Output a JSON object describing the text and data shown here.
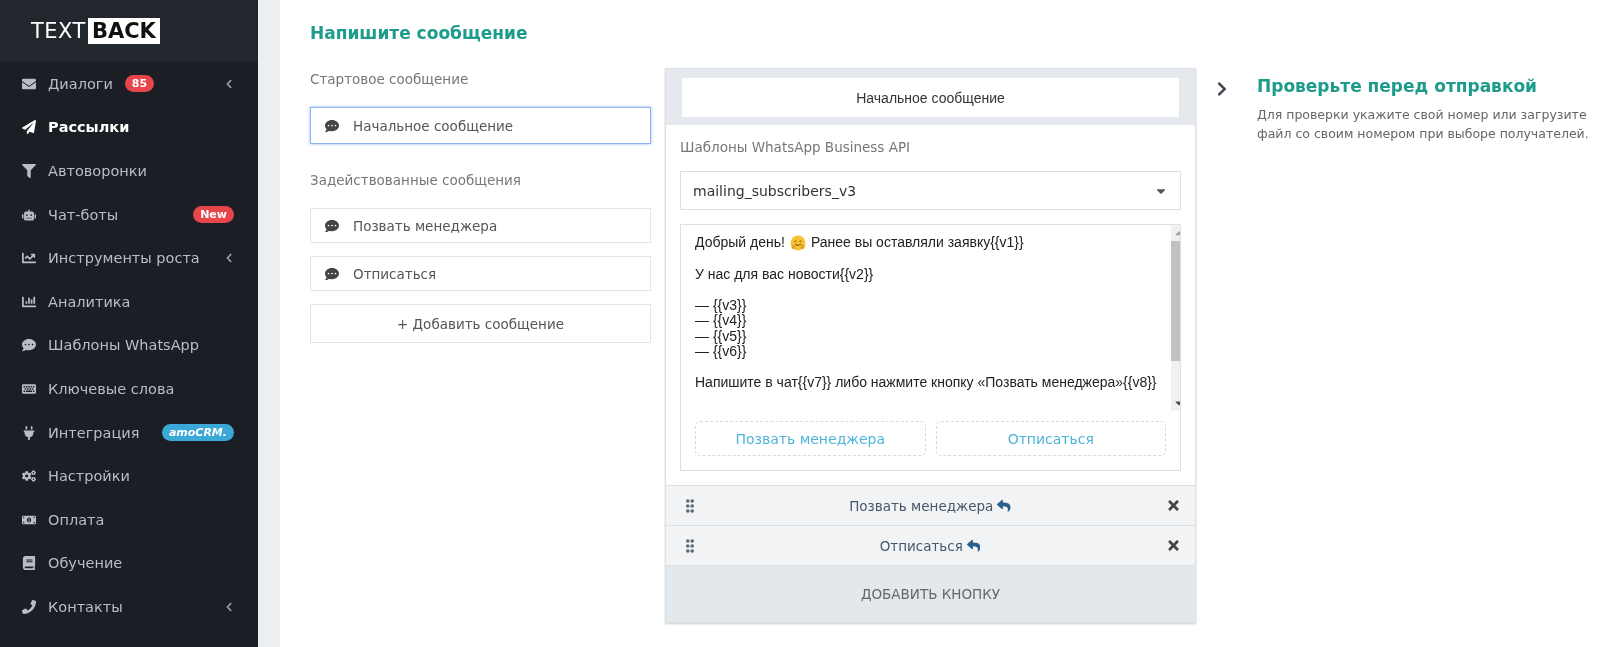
{
  "sidebar": {
    "logo": {
      "light": "TEXT",
      "bold": "BACK"
    },
    "items": [
      {
        "label": "Диалоги",
        "selected": false,
        "expandable": true,
        "badge": {
          "kind": "count",
          "text": "85"
        }
      },
      {
        "label": "Рассылки",
        "selected": true,
        "expandable": false
      },
      {
        "label": "Автоворонки",
        "selected": false,
        "expandable": false
      },
      {
        "label": "Чат-боты",
        "selected": false,
        "expandable": false,
        "badge": {
          "kind": "new",
          "text": "New"
        }
      },
      {
        "label": "Инструменты роста",
        "selected": false,
        "expandable": true
      },
      {
        "label": "Аналитика",
        "selected": false,
        "expandable": false
      },
      {
        "label": "Шаблоны WhatsApp",
        "selected": false,
        "expandable": false
      },
      {
        "label": "Ключевые слова",
        "selected": false,
        "expandable": false
      },
      {
        "label": "Интеграция",
        "selected": false,
        "expandable": false,
        "badge": {
          "kind": "brand",
          "text": "amoCRM."
        }
      },
      {
        "label": "Настройки",
        "selected": false,
        "expandable": false
      },
      {
        "label": "Оплата",
        "selected": false,
        "expandable": false
      },
      {
        "label": "Обучение",
        "selected": false,
        "expandable": false
      },
      {
        "label": "Контакты",
        "selected": false,
        "expandable": true
      }
    ]
  },
  "main": {
    "title": "Напишите сообщение",
    "start_section": {
      "label": "Стартовое сообщение",
      "items": [
        {
          "label": "Начальное сообщение",
          "selected": true
        }
      ]
    },
    "used_section": {
      "label": "Задействованные сообщения",
      "items": [
        {
          "label": "Позвать менеджера",
          "selected": false
        },
        {
          "label": "Отписаться",
          "selected": false
        }
      ]
    },
    "add_message": "+ Добавить сообщение"
  },
  "editor": {
    "tab": "Начальное сообщение",
    "template_label": "Шаблоны WhatsApp Business API",
    "template_select": {
      "value": "mailing_subscribers_v3"
    },
    "message": [
      {
        "kind": "greeting",
        "before": "Добрый день!",
        "after": "Ранее вы оставляли заявку{{v1}}"
      },
      {
        "kind": "text",
        "lines": [
          "У нас для вас новости{{v2}}"
        ]
      },
      {
        "kind": "text",
        "lines": [
          "— {{v3}}",
          "— {{v4}}",
          "— {{v5}}",
          "— {{v6}}"
        ]
      },
      {
        "kind": "text",
        "lines": [
          "Напишите в чат{{v7}} либо нажмите кнопку «Позвать менеджера»{{v8}}"
        ]
      }
    ],
    "preview_buttons": [
      "Позвать менеджера",
      "Отписаться"
    ],
    "button_rows": [
      {
        "label": "Позвать менеджера"
      },
      {
        "label": "Отписаться"
      }
    ],
    "add_button": "ДОБАВИТЬ КНОПКУ"
  },
  "check": {
    "title": "Проверьте перед отправкой",
    "description": "Для проверки укажите свой номер или загрузите файл со своим номером при выборе получателей."
  }
}
